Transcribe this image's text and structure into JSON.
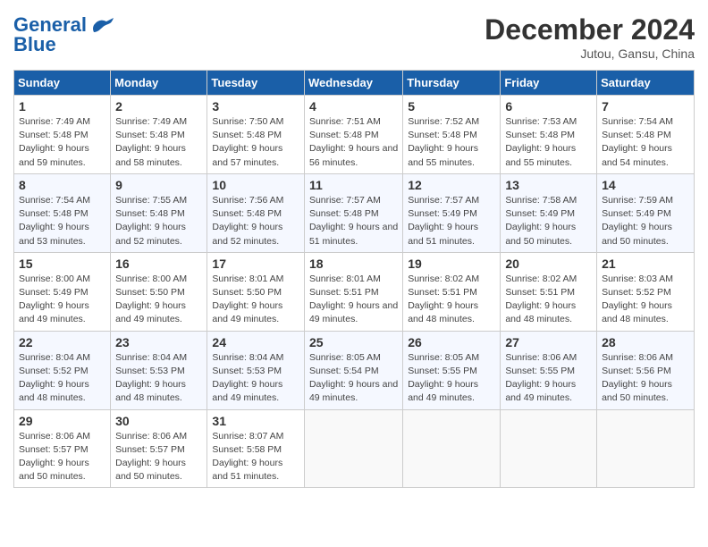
{
  "header": {
    "logo_general": "General",
    "logo_blue": "Blue",
    "month_title": "December 2024",
    "subtitle": "Jutou, Gansu, China"
  },
  "weekdays": [
    "Sunday",
    "Monday",
    "Tuesday",
    "Wednesday",
    "Thursday",
    "Friday",
    "Saturday"
  ],
  "weeks": [
    [
      {
        "day": "1",
        "sunrise": "7:49 AM",
        "sunset": "5:48 PM",
        "daylight": "9 hours and 59 minutes."
      },
      {
        "day": "2",
        "sunrise": "7:49 AM",
        "sunset": "5:48 PM",
        "daylight": "9 hours and 58 minutes."
      },
      {
        "day": "3",
        "sunrise": "7:50 AM",
        "sunset": "5:48 PM",
        "daylight": "9 hours and 57 minutes."
      },
      {
        "day": "4",
        "sunrise": "7:51 AM",
        "sunset": "5:48 PM",
        "daylight": "9 hours and 56 minutes."
      },
      {
        "day": "5",
        "sunrise": "7:52 AM",
        "sunset": "5:48 PM",
        "daylight": "9 hours and 55 minutes."
      },
      {
        "day": "6",
        "sunrise": "7:53 AM",
        "sunset": "5:48 PM",
        "daylight": "9 hours and 55 minutes."
      },
      {
        "day": "7",
        "sunrise": "7:54 AM",
        "sunset": "5:48 PM",
        "daylight": "9 hours and 54 minutes."
      }
    ],
    [
      {
        "day": "8",
        "sunrise": "7:54 AM",
        "sunset": "5:48 PM",
        "daylight": "9 hours and 53 minutes."
      },
      {
        "day": "9",
        "sunrise": "7:55 AM",
        "sunset": "5:48 PM",
        "daylight": "9 hours and 52 minutes."
      },
      {
        "day": "10",
        "sunrise": "7:56 AM",
        "sunset": "5:48 PM",
        "daylight": "9 hours and 52 minutes."
      },
      {
        "day": "11",
        "sunrise": "7:57 AM",
        "sunset": "5:48 PM",
        "daylight": "9 hours and 51 minutes."
      },
      {
        "day": "12",
        "sunrise": "7:57 AM",
        "sunset": "5:49 PM",
        "daylight": "9 hours and 51 minutes."
      },
      {
        "day": "13",
        "sunrise": "7:58 AM",
        "sunset": "5:49 PM",
        "daylight": "9 hours and 50 minutes."
      },
      {
        "day": "14",
        "sunrise": "7:59 AM",
        "sunset": "5:49 PM",
        "daylight": "9 hours and 50 minutes."
      }
    ],
    [
      {
        "day": "15",
        "sunrise": "8:00 AM",
        "sunset": "5:49 PM",
        "daylight": "9 hours and 49 minutes."
      },
      {
        "day": "16",
        "sunrise": "8:00 AM",
        "sunset": "5:50 PM",
        "daylight": "9 hours and 49 minutes."
      },
      {
        "day": "17",
        "sunrise": "8:01 AM",
        "sunset": "5:50 PM",
        "daylight": "9 hours and 49 minutes."
      },
      {
        "day": "18",
        "sunrise": "8:01 AM",
        "sunset": "5:51 PM",
        "daylight": "9 hours and 49 minutes."
      },
      {
        "day": "19",
        "sunrise": "8:02 AM",
        "sunset": "5:51 PM",
        "daylight": "9 hours and 48 minutes."
      },
      {
        "day": "20",
        "sunrise": "8:02 AM",
        "sunset": "5:51 PM",
        "daylight": "9 hours and 48 minutes."
      },
      {
        "day": "21",
        "sunrise": "8:03 AM",
        "sunset": "5:52 PM",
        "daylight": "9 hours and 48 minutes."
      }
    ],
    [
      {
        "day": "22",
        "sunrise": "8:04 AM",
        "sunset": "5:52 PM",
        "daylight": "9 hours and 48 minutes."
      },
      {
        "day": "23",
        "sunrise": "8:04 AM",
        "sunset": "5:53 PM",
        "daylight": "9 hours and 48 minutes."
      },
      {
        "day": "24",
        "sunrise": "8:04 AM",
        "sunset": "5:53 PM",
        "daylight": "9 hours and 49 minutes."
      },
      {
        "day": "25",
        "sunrise": "8:05 AM",
        "sunset": "5:54 PM",
        "daylight": "9 hours and 49 minutes."
      },
      {
        "day": "26",
        "sunrise": "8:05 AM",
        "sunset": "5:55 PM",
        "daylight": "9 hours and 49 minutes."
      },
      {
        "day": "27",
        "sunrise": "8:06 AM",
        "sunset": "5:55 PM",
        "daylight": "9 hours and 49 minutes."
      },
      {
        "day": "28",
        "sunrise": "8:06 AM",
        "sunset": "5:56 PM",
        "daylight": "9 hours and 50 minutes."
      }
    ],
    [
      {
        "day": "29",
        "sunrise": "8:06 AM",
        "sunset": "5:57 PM",
        "daylight": "9 hours and 50 minutes."
      },
      {
        "day": "30",
        "sunrise": "8:06 AM",
        "sunset": "5:57 PM",
        "daylight": "9 hours and 50 minutes."
      },
      {
        "day": "31",
        "sunrise": "8:07 AM",
        "sunset": "5:58 PM",
        "daylight": "9 hours and 51 minutes."
      },
      null,
      null,
      null,
      null
    ]
  ]
}
